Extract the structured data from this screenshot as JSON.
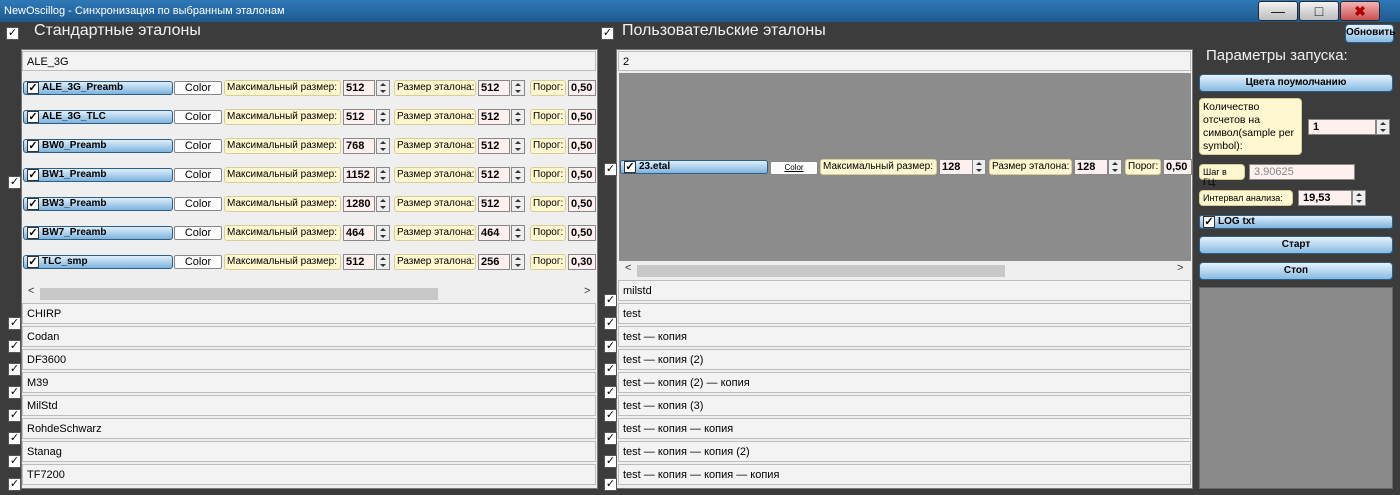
{
  "window": {
    "title": "NewOscillog - Синхронизация по выбранным эталонам",
    "minimize": "—",
    "maximize": "□",
    "close": "✖"
  },
  "std": {
    "header": "Стандартные эталоны",
    "group": "ALE_3G",
    "col_label": "Color",
    "max_label": "Максимальный размер:",
    "size_label": "Размер эталона:",
    "thr_label": "Порог:",
    "rows": [
      {
        "name": "ALE_3G_Preamb",
        "max": "512",
        "size": "512",
        "thr": "0,50"
      },
      {
        "name": "ALE_3G_TLC",
        "max": "512",
        "size": "512",
        "thr": "0,50"
      },
      {
        "name": "BW0_Preamb",
        "max": "768",
        "size": "512",
        "thr": "0,50"
      },
      {
        "name": "BW1_Preamb",
        "max": "1152",
        "size": "512",
        "thr": "0,50"
      },
      {
        "name": "BW3_Preamb",
        "max": "1280",
        "size": "512",
        "thr": "0,50"
      },
      {
        "name": "BW7_Preamb",
        "max": "464",
        "size": "464",
        "thr": "0,50"
      },
      {
        "name": "TLC_smp",
        "max": "512",
        "size": "256",
        "thr": "0,30"
      }
    ],
    "groups": [
      "CHIRP",
      "Codan",
      "DF3600",
      "M39",
      "MilStd",
      "RohdeSchwarz",
      "Stanag",
      "TF7200"
    ]
  },
  "user": {
    "header": "Пользовательские эталоны",
    "group": "2",
    "row": {
      "name": "23.etal",
      "color": "Color",
      "max_label": "Максимальный размер:",
      "max": "128",
      "size_label": "Размер эталона:",
      "size": "128",
      "thr_label": "Порог:",
      "thr": "0,50"
    },
    "groups": [
      "milstd",
      "test",
      "test — копия",
      "test — копия (2)",
      "test — копия (2) — копия",
      "test — копия (3)",
      "test — копия — копия",
      "test — копия — копия (2)",
      "test — копия — копия — копия"
    ]
  },
  "right": {
    "refresh": "Обновить",
    "params_title": "Параметры запуска:",
    "default_colors": "Цвета поумолчанию",
    "samples_label": "Количество отсчетов на символ(sample per symbol):",
    "samples_value": "1",
    "step_label": "Шаг в ГЦ:",
    "step_value": "3.90625",
    "interval_label": "Интервал анализа:",
    "interval_value": "19,53",
    "log_label": "LOG txt",
    "start": "Старт",
    "stop": "Стоп"
  }
}
